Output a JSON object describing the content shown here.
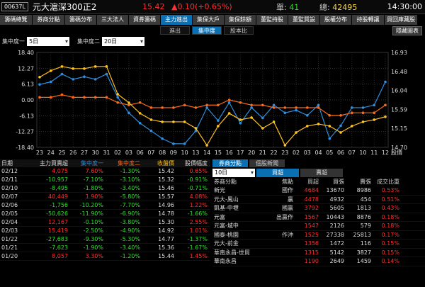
{
  "header": {
    "code": "00637L",
    "name": "元大滬深300正2",
    "price": "15.42",
    "change": "▲0.10(+0.65%)",
    "vol_label": "單:",
    "vol": "41",
    "tot_label": "總:",
    "tot": "42495",
    "time": "14:30:00"
  },
  "tabs": [
    "籌碼總覽",
    "券商分點",
    "籌碼分布",
    "三大法人",
    "資券籌碼",
    "主力進出",
    "集保大戶",
    "集保餘額",
    "董監持股",
    "董監質設",
    "股權分布",
    "持股轉讓",
    "買回庫藏股"
  ],
  "active_tab": 5,
  "subtabs": [
    "進出",
    "集中度",
    "股本比"
  ],
  "hide_label": "隱藏圖表",
  "params": {
    "label1": "集中度一",
    "value1": "5日",
    "label2": "集中度二",
    "value2": "20日"
  },
  "colors": {
    "blue": "#2f8fe0",
    "orange": "#ff6a1a",
    "yellow": "#ffc21c",
    "red": "#ff3030",
    "green": "#2ee02e"
  },
  "chart_data": {
    "type": "line",
    "categories": [
      "23",
      "24",
      "25",
      "26",
      "27",
      "30",
      "31",
      "02",
      "03",
      "06",
      "07",
      "08",
      "09",
      "10",
      "13",
      "14",
      "15",
      "16",
      "17",
      "20",
      "21",
      "22",
      "23",
      "02",
      "03",
      "04",
      "05",
      "06",
      "07",
      "10",
      "11",
      "12"
    ],
    "x_axis_end_label": "股價",
    "left_axis": {
      "ylim": [
        -18.4,
        18.4
      ],
      "ticks": [
        "18.40",
        "12.27",
        "6.13",
        "0.00",
        "-6.13",
        "-12.27",
        "-18.40"
      ]
    },
    "right_axis": {
      "ylim": [
        14.7,
        16.93
      ],
      "ticks": [
        "16.93",
        "16.48",
        "16.04",
        "15.59",
        "15.15",
        "14.70"
      ]
    },
    "series": [
      {
        "name": "集中度一",
        "axis": "left",
        "values": [
          6,
          7,
          10,
          8,
          9,
          8,
          10,
          1,
          -5,
          -9,
          -12,
          -15,
          -17,
          -17,
          -12,
          -3,
          -8,
          -1,
          -9,
          -3,
          -7,
          -2,
          -5,
          -4,
          -6,
          -2,
          -15,
          -10,
          -3,
          -3,
          -2,
          7
        ]
      },
      {
        "name": "集中度二",
        "axis": "left",
        "values": [
          1,
          1,
          2,
          1,
          1,
          1,
          1,
          -1,
          -2,
          -1,
          -3,
          -3,
          -3,
          -2,
          -3,
          -2,
          -2,
          0,
          -1,
          -2,
          -2,
          -3,
          -3,
          -3,
          -3,
          -3,
          -6,
          -6,
          -5,
          -5,
          -5,
          -2
        ]
      },
      {
        "name": "股價",
        "axis": "right",
        "values": [
          16.35,
          16.5,
          16.6,
          16.55,
          16.55,
          16.6,
          16.6,
          15.95,
          15.75,
          15.5,
          15.35,
          15.3,
          15.3,
          15.3,
          15.15,
          14.75,
          15.2,
          15.5,
          15.35,
          15.4,
          15.15,
          15.3,
          14.75,
          15.05,
          15.2,
          15.25,
          15.2,
          15.05,
          15.2,
          15.3,
          15.35,
          15.42
        ]
      }
    ]
  },
  "left_table": {
    "headers": [
      "日期",
      "主力買賣超",
      "集中度一",
      "集中度二",
      "收盤價",
      "股價幅度"
    ],
    "rows": [
      [
        "02/12",
        "4,075",
        "7.60%",
        "-1.30%",
        "15.42",
        "0.65%"
      ],
      [
        "02/11",
        "-10,957",
        "-7.10%",
        "-3.10%",
        "15.32",
        "-0.91%"
      ],
      [
        "02/10",
        "-8,495",
        "-1.80%",
        "-3.40%",
        "15.46",
        "-0.71%"
      ],
      [
        "02/07",
        "40,449",
        "1.90%",
        "-5.80%",
        "15.57",
        "4.08%"
      ],
      [
        "02/06",
        "-1,756",
        "-10.20%",
        "-7.70%",
        "14.96",
        "1.22%"
      ],
      [
        "02/05",
        "-50,626",
        "-11.90%",
        "-6.90%",
        "14.78",
        "-1.66%"
      ],
      [
        "02/04",
        "12,167",
        "-0.10%",
        "-3.80%",
        "15.30",
        "2.55%"
      ],
      [
        "02/03",
        "15,419",
        "-2.50%",
        "-4.90%",
        "14.92",
        "1.01%"
      ],
      [
        "01/22",
        "-27,683",
        "-9.30%",
        "-5.30%",
        "14.77",
        "-1.37%"
      ],
      [
        "01/21",
        "-7,623",
        "-1.90%",
        "-3.40%",
        "15.36",
        "-1.67%"
      ],
      [
        "01/20",
        "8,057",
        "3.30%",
        "-1.20%",
        "15.44",
        "1.45%"
      ]
    ]
  },
  "right_panel": {
    "tabs": [
      "券商分點",
      "個股新聞"
    ],
    "period": "10日",
    "buy_label": "買超",
    "sell_label": "賣超",
    "headers": [
      "券商分點",
      "焦點",
      "買超",
      "買張",
      "賣張",
      "成交比重"
    ],
    "rows": [
      [
        "新光",
        "國作",
        "4684",
        "13670",
        "8986",
        "0.53%"
      ],
      [
        "元大-鳳山",
        "贏",
        "4478",
        "4932",
        "454",
        "0.51%"
      ],
      [
        "凱基-中壢",
        "國贏",
        "3792",
        "5605",
        "1813",
        "0.43%"
      ],
      [
        "元富",
        "出贏作",
        "1567",
        "10443",
        "8876",
        "0.18%"
      ],
      [
        "元富-城中",
        "",
        "1547",
        "2126",
        "579",
        "0.18%"
      ],
      [
        "國泰-桃園",
        "作沖",
        "1525",
        "27338",
        "25813",
        "0.17%"
      ],
      [
        "元大-前金",
        "",
        "1356",
        "1472",
        "116",
        "0.15%"
      ],
      [
        "華南永昌-世貿",
        "",
        "1315",
        "5142",
        "3827",
        "0.15%"
      ],
      [
        "華南永昌",
        "",
        "1190",
        "2649",
        "1459",
        "0.14%"
      ]
    ]
  }
}
